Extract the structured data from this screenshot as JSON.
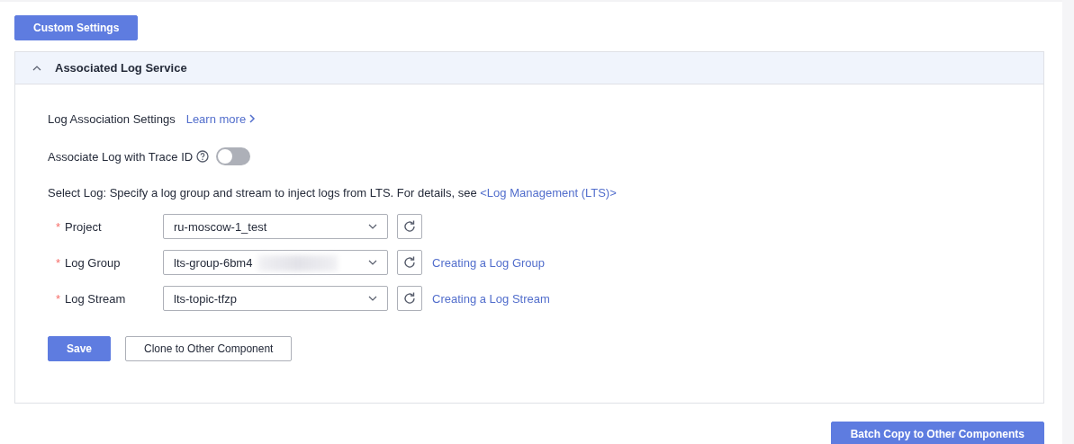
{
  "top_button": "Custom Settings",
  "panel": {
    "title": "Associated Log Service",
    "expanded": true,
    "settings_label": "Log Association Settings",
    "learn_more": "Learn more",
    "trace_toggle": {
      "label": "Associate Log with Trace ID",
      "on": false
    },
    "select_text": "Select Log: Specify a log group and stream to inject logs from LTS. For details, see ",
    "select_link": "<Log Management (LTS)>",
    "fields": [
      {
        "label": "Project",
        "required_mark": "*",
        "value": "ru-moscow-1_test",
        "blurred": false
      },
      {
        "label": "Log Group",
        "required_mark": "*",
        "value": "lts-group-6bm4",
        "blurred": true,
        "link": "Creating a Log Group"
      },
      {
        "label": "Log Stream",
        "required_mark": "*",
        "value": "lts-topic-tfzp",
        "blurred": false,
        "link": "Creating a Log Stream"
      }
    ],
    "buttons": [
      {
        "label": "Save",
        "kind": "primary"
      },
      {
        "label": "Clone to Other Component",
        "kind": "secondary"
      }
    ]
  },
  "bottom_button": "Batch Copy to Other Components"
}
